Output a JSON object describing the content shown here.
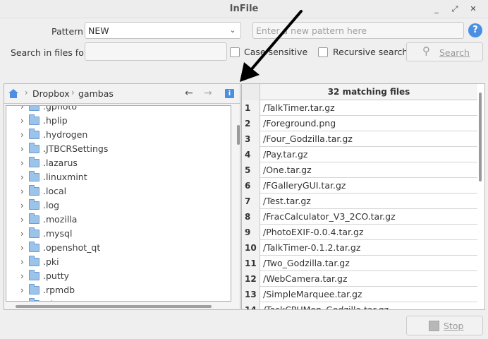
{
  "window": {
    "title": "InFile",
    "controls": [
      "minimize",
      "restore",
      "close"
    ]
  },
  "pattern": {
    "label": "Pattern",
    "value": "NEW",
    "new_pattern_placeholder": "Enter a new pattern here"
  },
  "search_in_files": {
    "label": "Search in files for",
    "value": ""
  },
  "options": {
    "case_sensitive": "Case sensitive",
    "recursive": "Recursive search"
  },
  "buttons": {
    "search": "Search",
    "stop": "Stop",
    "help": "?"
  },
  "breadcrumb": [
    "Dropbox",
    "gambas"
  ],
  "folders": [
    ".gphoto",
    ".hplip",
    ".hydrogen",
    ".JTBCRSettings",
    ".lazarus",
    ".linuxmint",
    ".local",
    ".log",
    ".mozilla",
    ".mysql",
    ".openshot_qt",
    ".pki",
    ".putty",
    ".rpmdb",
    ".shutter"
  ],
  "results": {
    "header": "32 matching files",
    "rows": [
      {
        "num": "1",
        "file": "/TalkTimer.tar.gz"
      },
      {
        "num": "2",
        "file": "/Foreground.png"
      },
      {
        "num": "3",
        "file": "/Four_Godzilla.tar.gz"
      },
      {
        "num": "4",
        "file": "/Pay.tar.gz"
      },
      {
        "num": "5",
        "file": "/One.tar.gz"
      },
      {
        "num": "6",
        "file": "/FGalleryGUI.tar.gz"
      },
      {
        "num": "7",
        "file": "/Test.tar.gz"
      },
      {
        "num": "8",
        "file": "/FracCalculator_V3_2CO.tar.gz"
      },
      {
        "num": "9",
        "file": "/PhotoEXIF-0.0.4.tar.gz"
      },
      {
        "num": "10",
        "file": "/TalkTimer-0.1.2.tar.gz"
      },
      {
        "num": "11",
        "file": "/Two_Godzilla.tar.gz"
      },
      {
        "num": "12",
        "file": "/WebCamera.tar.gz"
      },
      {
        "num": "13",
        "file": "/SimpleMarquee.tar.gz"
      },
      {
        "num": "14",
        "file": "/TaskCPUMon_Godzilla.tar.gz"
      }
    ]
  },
  "colors": {
    "accent": "#4a8fe2",
    "folder": "#9cc3ea"
  }
}
